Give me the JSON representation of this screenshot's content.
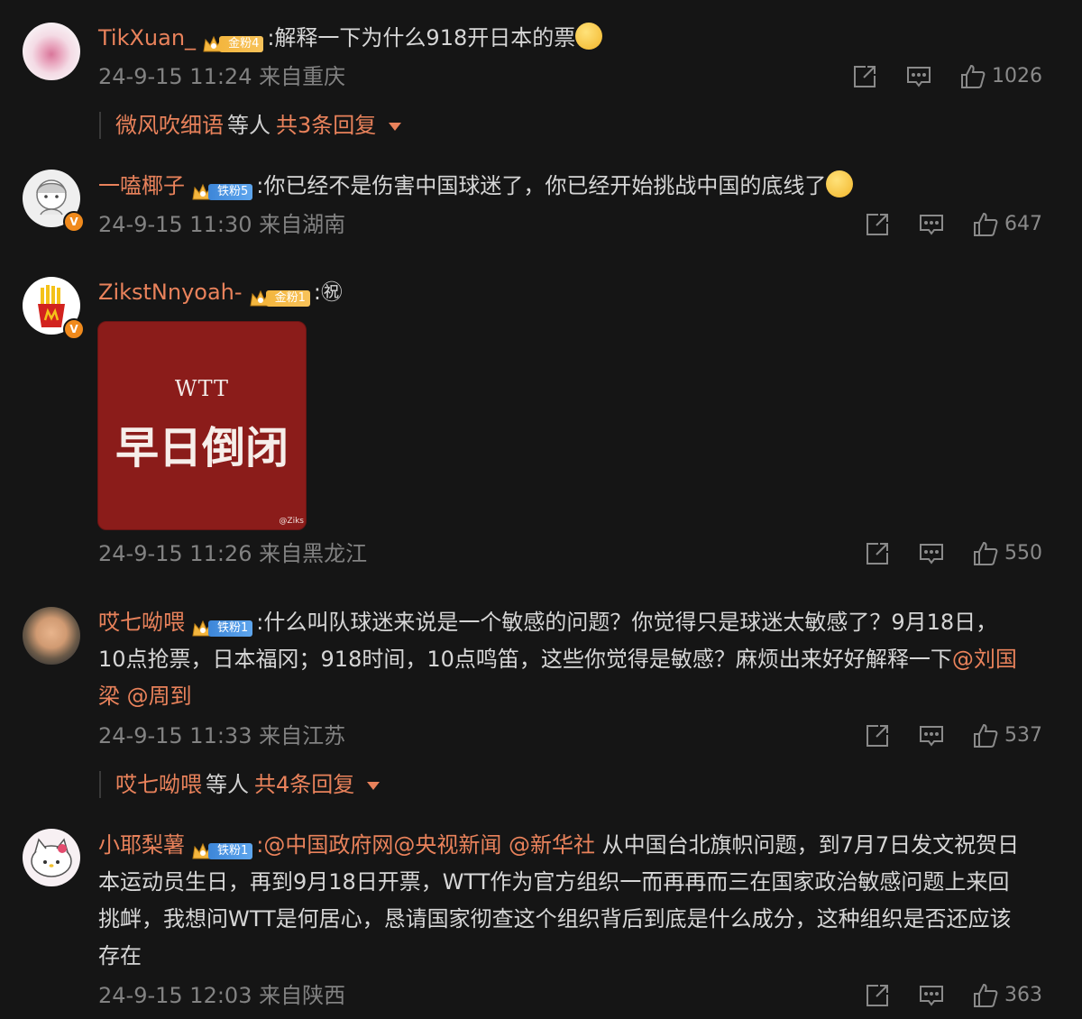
{
  "comments": [
    {
      "username": "TikXuan_",
      "badge": "金粉4",
      "text": ":解释一下为什么918开日本的票",
      "time": "24-9-15 11:24",
      "location": "来自重庆",
      "likes": "1026",
      "replies": {
        "who": "微风吹细语",
        "etc": "等人",
        "total": "共3条回复"
      }
    },
    {
      "username": "一嗑椰子",
      "badge": "铁粉5",
      "text": ":你已经不是伤害中国球迷了，你已经开始挑战中国的底线了",
      "time": "24-9-15 11:30",
      "location": "来自湖南",
      "likes": "647"
    },
    {
      "username": "ZikstNnyoah-",
      "badge": "金粉1",
      "text": ":㊗",
      "image": {
        "line1": "WTT",
        "line2": "早日倒闭",
        "watermark": "@Ziks"
      },
      "time": "24-9-15 11:26",
      "location": "来自黑龙江",
      "likes": "550"
    },
    {
      "username": "哎七呦喂",
      "badge": "铁粉1",
      "text_line1": ":什么叫队球迷来说是一个敏感的问题？你觉得只是球迷太敏感了？9月18日，",
      "text_line2_plain": "10点抢票，日本福冈；918时间，10点鸣笛，这些你觉得是敏感？麻烦出来好好解释一下",
      "mention1_a": "@刘国",
      "mention1_b": "梁",
      "mention2": "@周到",
      "time": "24-9-15 11:33",
      "location": "来自江苏",
      "likes": "537",
      "replies": {
        "who": "哎七呦喂",
        "etc": "等人",
        "total": "共4条回复"
      }
    },
    {
      "username": "小耶梨薯",
      "badge": "铁粉1",
      "mentions": ":@中国政府网@央视新闻 @新华社",
      "text_line1": " 从中国台北旗帜问题，到7月7日发文祝贺日",
      "text_line2": "本运动员生日，再到9月18日开票，WTT作为官方组织一而再再而三在国家政治敏感问题上来回",
      "text_line3": "挑衅，我想问WTT是何居心，恳请国家彻查这个组织背后到底是什么成分，这种组织是否还应该",
      "text_line4": "存在",
      "time": "24-9-15 12:03",
      "location": "来自陕西",
      "likes": "363"
    }
  ],
  "colors": {
    "username": "#e9825b",
    "background": "#151515",
    "meta": "#828282"
  },
  "icons": [
    "share-icon",
    "comment-icon",
    "like-icon",
    "crown-icon",
    "verified-icon"
  ]
}
